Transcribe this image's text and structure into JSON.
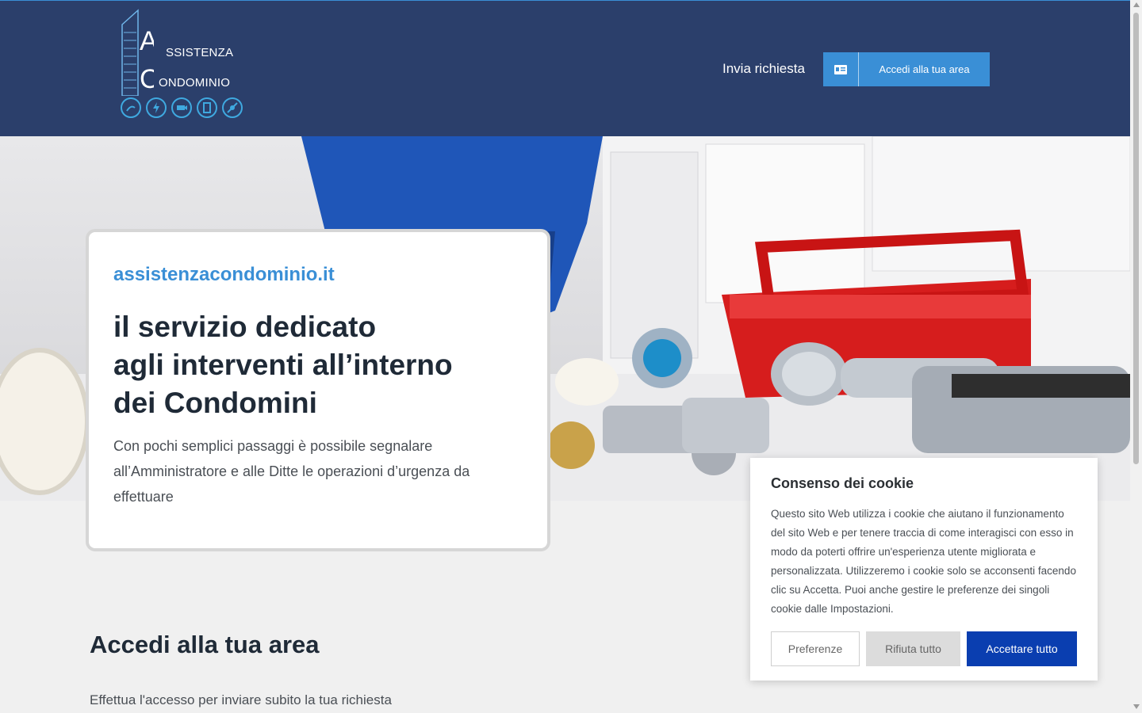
{
  "header": {
    "logo": {
      "line1": "SSISTENZA",
      "line2": "ONDOMINIO",
      "icons": [
        "plumbing-icon",
        "electric-icon",
        "camera-icon",
        "door-icon",
        "pest-icon"
      ]
    },
    "nav_link": "Invia richiesta",
    "area_button": {
      "label": "Accedi alla tua area",
      "icon": "id-card-icon"
    }
  },
  "hero": {
    "site": "assistenzacondominio.it",
    "title_lines": [
      "il servizio dedicato",
      "agli interventi all’interno",
      "dei Condomini"
    ],
    "description": "Con pochi semplici passaggi è possibile segnalare all’Amministratore e alle Ditte le operazioni d’urgenza da effettuare"
  },
  "section": {
    "title": "Accedi alla tua area",
    "description": "Effettua l'accesso per inviare subito la tua richiesta"
  },
  "cookie": {
    "title": "Consenso dei cookie",
    "text": "Questo sito Web utilizza i cookie che aiutano il funzionamento del sito Web e per tenere traccia di come interagisci con esso in modo da poterti offrire un'esperienza utente migliorata e personalizzata. Utilizzeremo i cookie solo se acconsenti facendo clic su Accetta. Puoi anche gestire le preferenze dei singoli cookie dalle Impostazioni.",
    "preferences": "Preferenze",
    "reject": "Rifiuta tutto",
    "accept": "Accettare tutto"
  },
  "colors": {
    "header_bg": "#2b3f6b",
    "accent": "#3a8fd6",
    "accept_button": "#0a3eb0"
  }
}
